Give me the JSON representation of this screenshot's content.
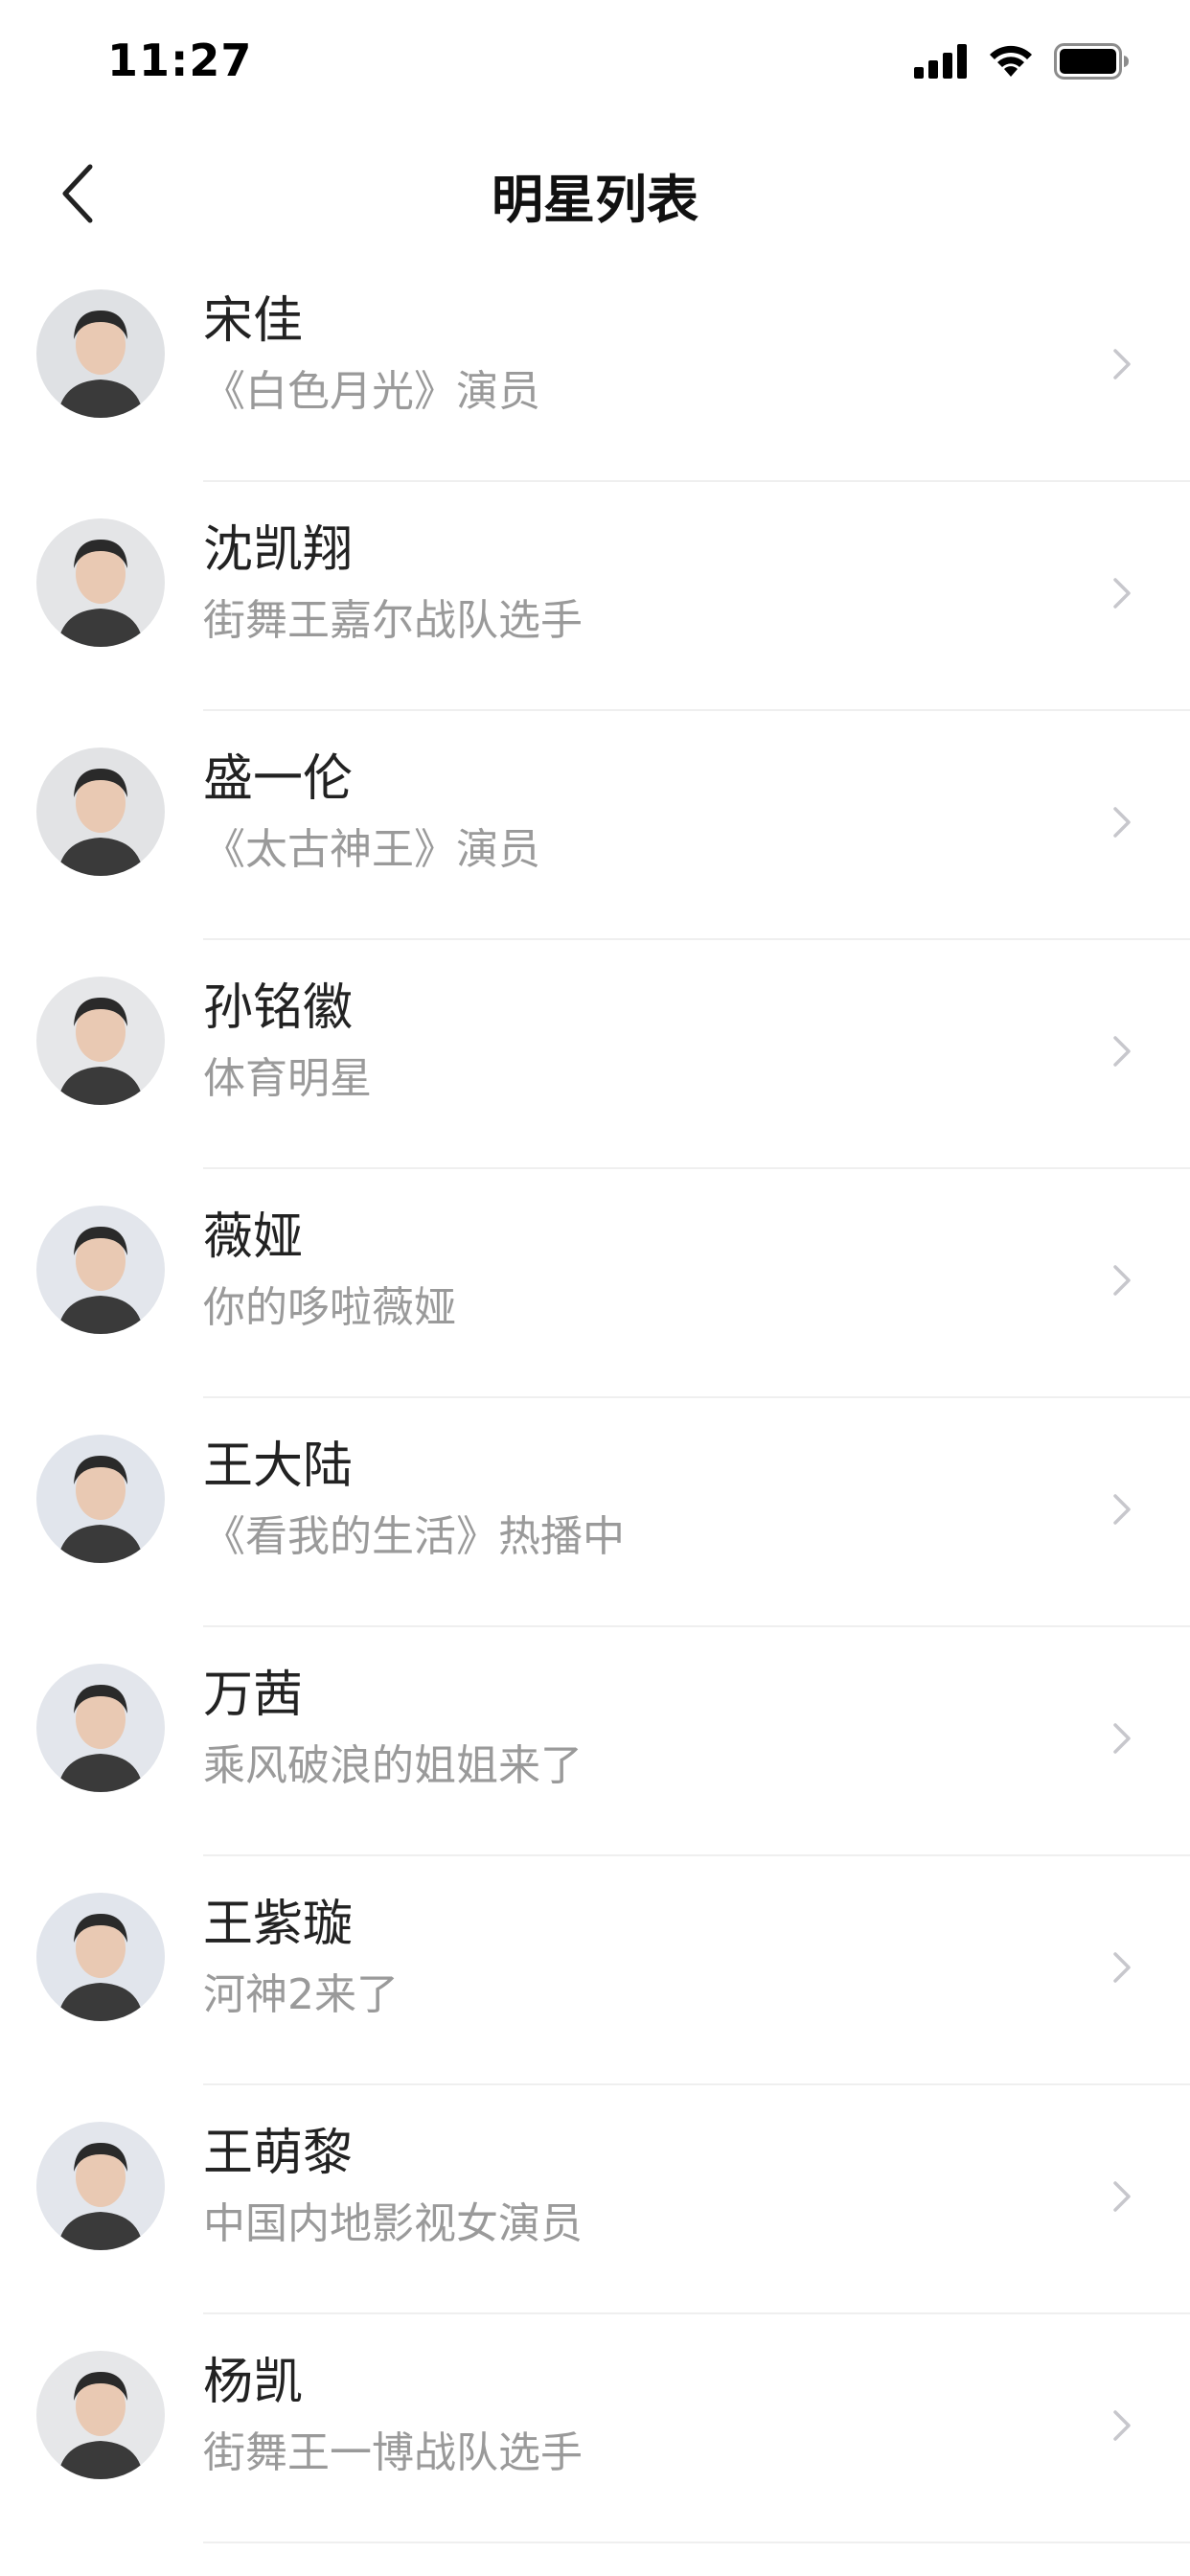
{
  "status_bar": {
    "time": "11:27",
    "icons": [
      "signal-icon",
      "wifi-icon",
      "battery-icon"
    ]
  },
  "nav": {
    "title": "明星列表",
    "back_icon": "chevron-left-icon"
  },
  "list": {
    "items": [
      {
        "name": "宋佳",
        "desc": "《白色月光》演员",
        "avatar_bg": "#dfe1e4"
      },
      {
        "name": "沈凯翔",
        "desc": "街舞王嘉尔战队选手",
        "avatar_bg": "#e4e5e7"
      },
      {
        "name": "盛一伦",
        "desc": "《太古神王》演员",
        "avatar_bg": "#e2e3e5"
      },
      {
        "name": "孙铭徽",
        "desc": "体育明星",
        "avatar_bg": "#e6e7e9"
      },
      {
        "name": "薇娅",
        "desc": "你的哆啦薇娅",
        "avatar_bg": "#e3e6ec"
      },
      {
        "name": "王大陆",
        "desc": "《看我的生活》热播中",
        "avatar_bg": "#e1e5ec"
      },
      {
        "name": "万茜",
        "desc": "乘风破浪的姐姐来了",
        "avatar_bg": "#e3e6ec"
      },
      {
        "name": "王紫璇",
        "desc": "河神2来了",
        "avatar_bg": "#e1e5ec"
      },
      {
        "name": "王萌黎",
        "desc": "中国内地影视女演员",
        "avatar_bg": "#e3e6ec"
      },
      {
        "name": "杨凯",
        "desc": "街舞王一博战队选手",
        "avatar_bg": "#e6e7e9"
      }
    ]
  },
  "colors": {
    "name": "#222222",
    "desc": "#9a9a9a",
    "chevron": "#c7c7cc",
    "divider": "#efefef"
  }
}
